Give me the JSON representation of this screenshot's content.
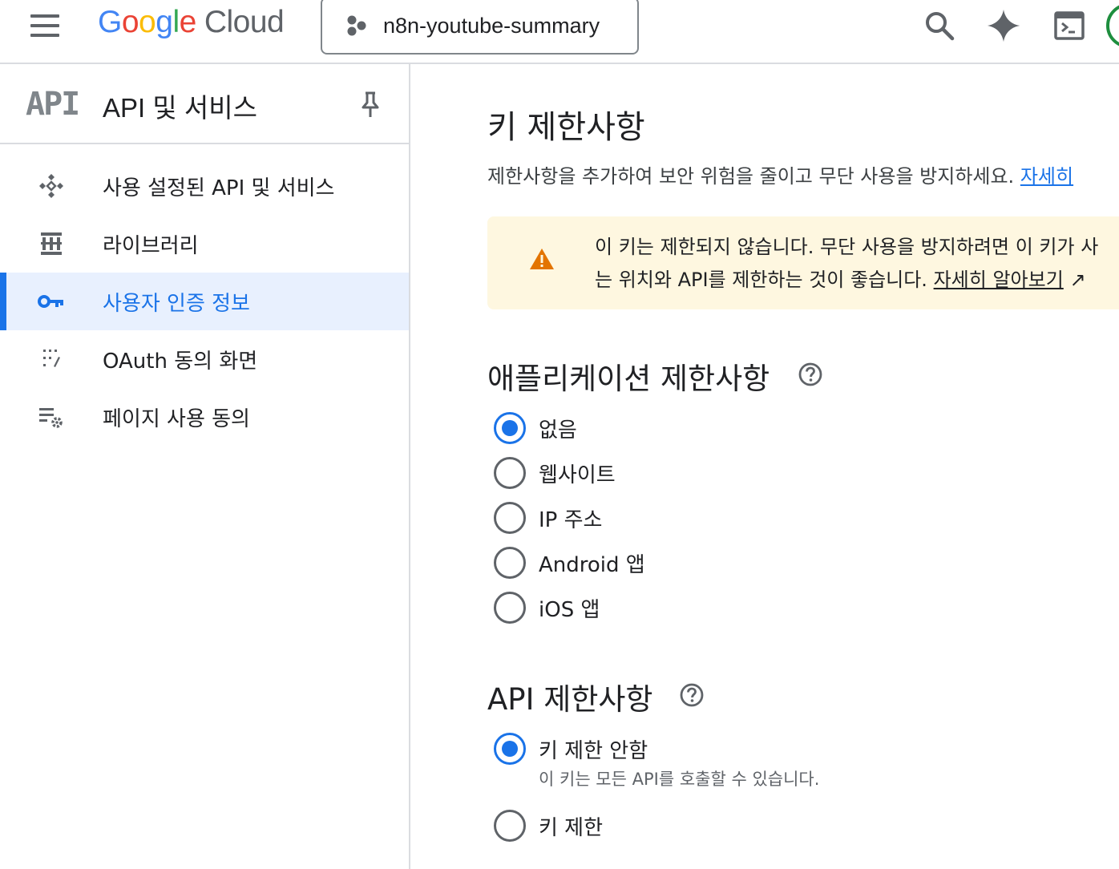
{
  "header": {
    "logo_google": "Google",
    "logo_cloud": "Cloud",
    "project_name": "n8n-youtube-summary",
    "icons": [
      "menu-icon",
      "search-icon",
      "gemini-sparkle-icon",
      "cloud-shell-icon",
      "avatar"
    ]
  },
  "sidebar": {
    "logo": "API",
    "title": "API 및 서비스",
    "items": [
      {
        "label": "사용 설정된 API 및 서비스",
        "icon": "apis-icon",
        "active": false
      },
      {
        "label": "라이브러리",
        "icon": "library-icon",
        "active": false
      },
      {
        "label": "사용자 인증 정보",
        "icon": "key-icon",
        "active": true
      },
      {
        "label": "OAuth 동의 화면",
        "icon": "oauth-icon",
        "active": false
      },
      {
        "label": "페이지 사용 동의",
        "icon": "page-usage-icon",
        "active": false
      }
    ]
  },
  "main": {
    "title": "키 제한사항",
    "subtitle": "제한사항을 추가하여 보안 위험을 줄이고 무단 사용을 방지하세요.",
    "subtitle_link": "자세히",
    "warning": {
      "line1": "이 키는 제한되지 않습니다. 무단 사용을 방지하려면 이 키가 사",
      "line2": "는 위치와 API를 제한하는 것이 좋습니다.",
      "link": "자세히 알아보기"
    },
    "app_restrictions": {
      "title": "애플리케이션 제한사항",
      "options": [
        {
          "label": "없음",
          "checked": true
        },
        {
          "label": "웹사이트",
          "checked": false
        },
        {
          "label": "IP 주소",
          "checked": false
        },
        {
          "label": "Android 앱",
          "checked": false
        },
        {
          "label": "iOS 앱",
          "checked": false
        }
      ]
    },
    "api_restrictions": {
      "title": "API 제한사항",
      "options": [
        {
          "label": "키 제한 안함",
          "description": "이 키는 모든 API를 호출할 수 있습니다.",
          "checked": true
        },
        {
          "label": "키 제한",
          "checked": false
        }
      ]
    }
  },
  "colors": {
    "accent": "#1a73e8",
    "active_bg": "#e8f0fe",
    "warning_bg": "#fef7e0",
    "warning_icon": "#e37400"
  }
}
